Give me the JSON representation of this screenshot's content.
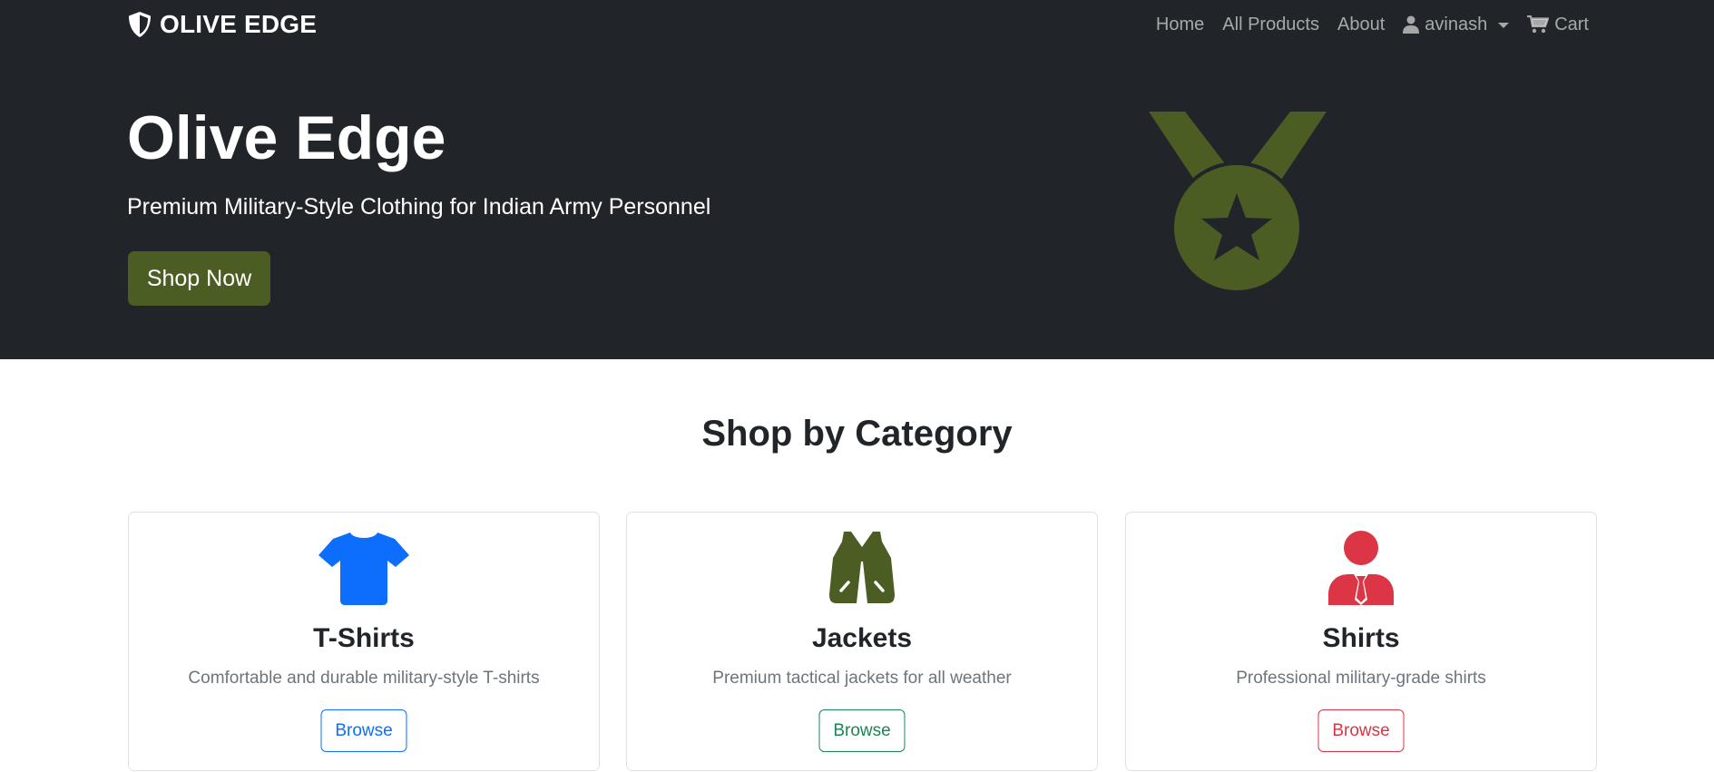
{
  "nav": {
    "brand": "OLIVE EDGE",
    "links": {
      "home": "Home",
      "all_products": "All Products",
      "about": "About",
      "user": "avinash",
      "cart": "Cart"
    }
  },
  "hero": {
    "title": "Olive Edge",
    "subtitle": "Premium Military-Style Clothing for Indian Army Personnel",
    "cta": "Shop Now",
    "icon": "medal-icon"
  },
  "categories": {
    "title": "Shop by Category",
    "items": [
      {
        "name": "T-Shirts",
        "desc": "Comfortable and durable military-style T-shirts",
        "button": "Browse",
        "color": "#0d6efd",
        "icon": "tshirt-icon"
      },
      {
        "name": "Jackets",
        "desc": "Premium tactical jackets for all weather",
        "button": "Browse",
        "color": "#198754",
        "icon": "vest-icon"
      },
      {
        "name": "Shirts",
        "desc": "Professional military-grade shirts",
        "button": "Browse",
        "color": "#dc3545",
        "icon": "user-tie-icon"
      }
    ]
  },
  "colors": {
    "dark_bg": "#212529",
    "olive": "#4b5d23",
    "jacket_icon": "#4b5d23"
  }
}
